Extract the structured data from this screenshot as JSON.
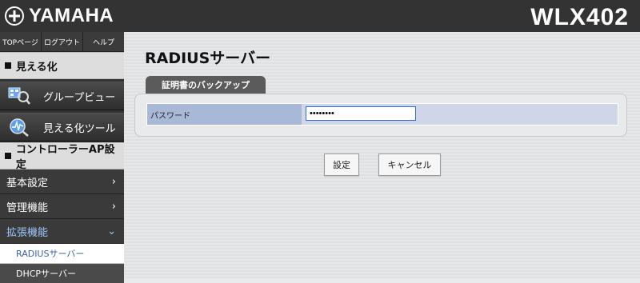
{
  "header": {
    "brand": "YAMAHA",
    "model": "WLX402"
  },
  "sidebar": {
    "topnav": [
      "TOPページ",
      "ログアウト",
      "ヘルプ"
    ],
    "section1": {
      "title": "見える化"
    },
    "bigbuttons": [
      {
        "label": "グループビュー",
        "icon": "group-view-icon"
      },
      {
        "label": "見える化ツール",
        "icon": "visualization-tool-icon"
      }
    ],
    "section2": {
      "title": "コントローラーAP設定"
    },
    "menu": [
      {
        "label": "基本設定",
        "chevron": "›"
      },
      {
        "label": "管理機能",
        "chevron": "›"
      },
      {
        "label": "拡張機能",
        "chevron": "⌄"
      }
    ],
    "submenu": [
      "RADIUSサーバー",
      "DHCPサーバー"
    ]
  },
  "main": {
    "title": "RADIUSサーバー",
    "tab_label": "証明書のバックアップ",
    "password_label": "パスワード",
    "password_value": "••••••••",
    "set_button": "設定",
    "cancel_button": "キャンセル"
  }
}
